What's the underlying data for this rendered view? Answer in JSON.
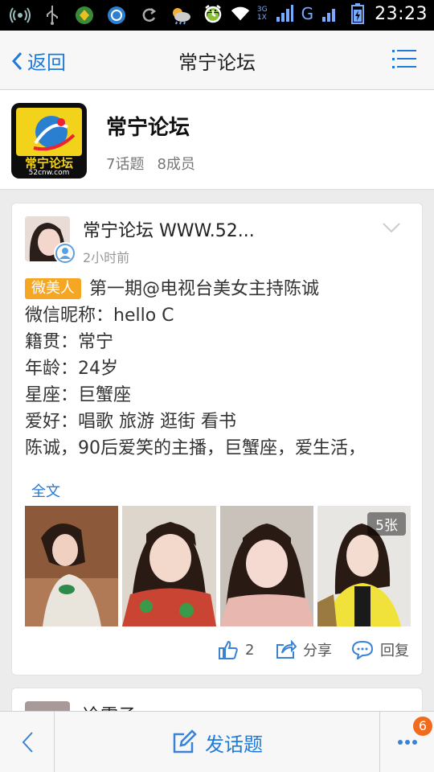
{
  "status_bar": {
    "time": "23:23",
    "icons": [
      "signal-broadcast-icon",
      "usb-icon",
      "app-green-icon",
      "browser-icon",
      "sync-icon",
      "weather-icon",
      "android-icon",
      "alarm-icon",
      "wifi-icon",
      "cell-signal-icon",
      "battery-charging-icon"
    ],
    "net_label_top": "3G",
    "net_label_bottom": "1X",
    "sim_label": "G"
  },
  "header": {
    "back_label": "返回",
    "title": "常宁论坛"
  },
  "forum": {
    "name": "常宁论坛",
    "topics": "7话题",
    "members": "8成员",
    "logo_text_top": "常宁论坛",
    "logo_text_bottom": "52cnw.com"
  },
  "post": {
    "author": "常宁论坛 WWW.52...",
    "time": "2小时前",
    "tag": "微美人",
    "title": "第一期@电视台美女主持陈诚",
    "lines": [
      "微信昵称：hello C",
      "籍贯：常宁",
      "年龄：24岁",
      "星座：巨蟹座",
      "爱好：唱歌 旅游 逛街 看书",
      "陈诚，90后爱笑的主播，巨蟹座，爱生活，"
    ],
    "full_text_link": "全文",
    "photo_count": "5张",
    "likes": "2",
    "share_label": "分享",
    "reply_label": "回复"
  },
  "next_post": {
    "author": "冷雪子"
  },
  "bottom_bar": {
    "post_label": "发话题",
    "more_badge": "6"
  },
  "colors": {
    "accent": "#1f7ad8",
    "tag": "#f5a623",
    "badge": "#f26a1b"
  }
}
